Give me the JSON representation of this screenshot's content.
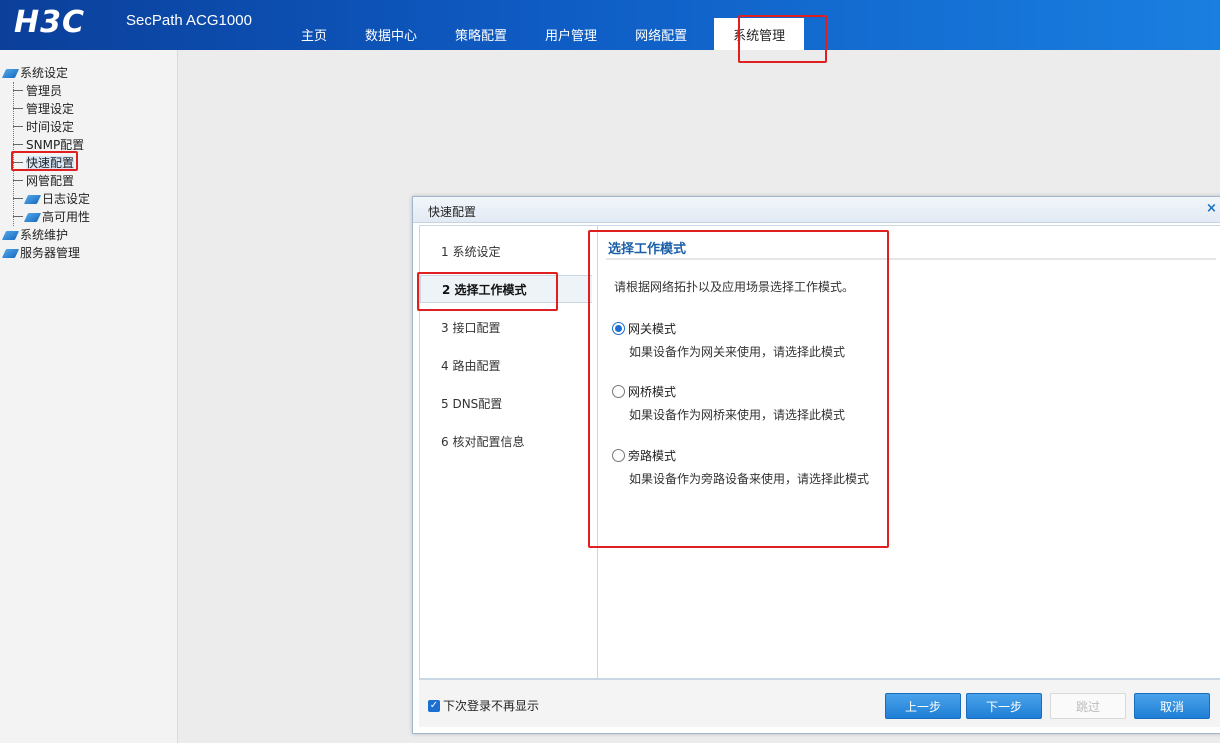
{
  "header": {
    "logo": "H3C",
    "product": "SecPath ACG1000",
    "nav": [
      "主页",
      "数据中心",
      "策略配置",
      "用户管理",
      "网络配置",
      "系统管理"
    ],
    "active_nav": "系统管理"
  },
  "sidebar": {
    "root": "系统设定",
    "children": [
      "管理员",
      "管理设定",
      "时间设定",
      "SNMP配置",
      "快速配置",
      "网管配置"
    ],
    "sub_folders": [
      "日志设定",
      "高可用性"
    ],
    "other_roots": [
      "系统维护",
      "服务器管理"
    ],
    "selected": "快速配置"
  },
  "dialog": {
    "title": "快速配置",
    "close": "×",
    "steps": [
      "1 系统设定",
      "2 选择工作模式",
      "3 接口配置",
      "4 路由配置",
      "5 DNS配置",
      "6 核对配置信息"
    ],
    "active_step": "2 选择工作模式",
    "content": {
      "title": "选择工作模式",
      "description": "请根据网络拓扑以及应用场景选择工作模式。",
      "options": [
        {
          "label": "网关模式",
          "desc": "如果设备作为网关来使用，请选择此模式",
          "checked": true
        },
        {
          "label": "网桥模式",
          "desc": "如果设备作为网桥来使用，请选择此模式",
          "checked": false
        },
        {
          "label": "旁路模式",
          "desc": "如果设备作为旁路设备来使用，请选择此模式",
          "checked": false
        }
      ]
    },
    "footer": {
      "checkbox_label": "下次登录不再显示",
      "checkbox_checked": true,
      "prev": "上一步",
      "next": "下一步",
      "skip": "跳过",
      "cancel": "取消"
    }
  },
  "colors": {
    "header_start": "#0b3f9a",
    "header_end": "#1a7fe0",
    "accent_blue": "#1a6fd0",
    "highlight_red": "#e02020"
  },
  "icons": [
    "folder-icon",
    "close-icon",
    "radio-icon",
    "checkbox-icon"
  ]
}
